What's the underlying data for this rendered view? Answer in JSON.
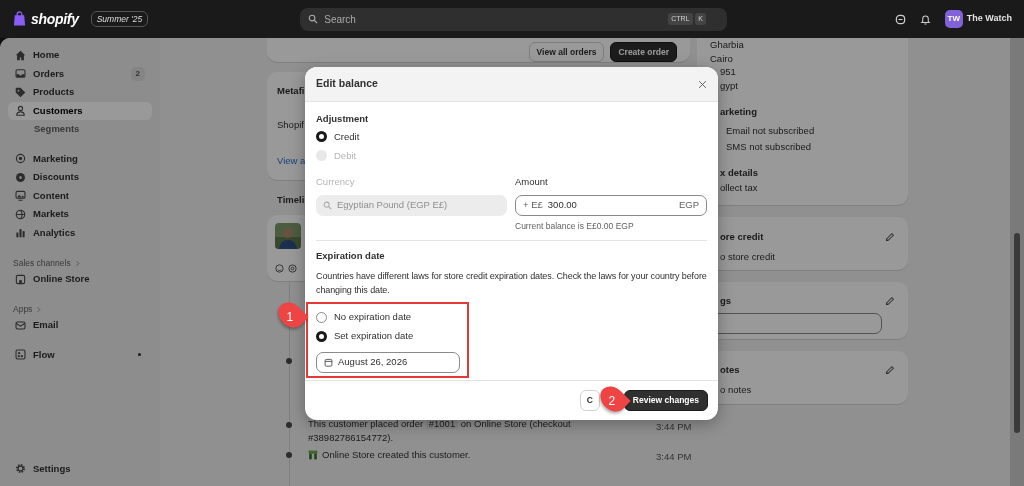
{
  "top_bar": {
    "logo": "shopify",
    "edition": "Summer '25",
    "search": {
      "placeholder": "Search"
    },
    "shortcut_keys": [
      "CTRL",
      "K"
    ],
    "account": {
      "initials": "TW",
      "name": "The Watch"
    }
  },
  "sidebar": {
    "groups": [
      [
        {
          "kind": "item",
          "label": "Home",
          "selected": false
        },
        {
          "kind": "item",
          "label": "Orders",
          "selected": false,
          "badge": "2"
        },
        {
          "kind": "item",
          "label": "Products",
          "selected": false
        },
        {
          "kind": "item",
          "label": "Customers",
          "selected": true
        },
        {
          "kind": "subitem",
          "label": "Segments",
          "selected": false
        }
      ],
      [
        {
          "kind": "item",
          "label": "Marketing",
          "selected": false
        },
        {
          "kind": "item",
          "label": "Discounts",
          "selected": false
        },
        {
          "kind": "item",
          "label": "Content",
          "selected": false
        },
        {
          "kind": "item",
          "label": "Markets",
          "selected": false
        },
        {
          "kind": "item",
          "label": "Analytics",
          "selected": false
        }
      ],
      [
        {
          "kind": "section",
          "label": "Sales channels"
        },
        {
          "kind": "item",
          "label": "Online Store",
          "selected": false
        }
      ],
      [
        {
          "kind": "section",
          "label": "Apps"
        },
        {
          "kind": "item",
          "label": "Email",
          "selected": false
        }
      ],
      [
        {
          "kind": "item",
          "label": "Flow",
          "selected": false,
          "unread": true
        }
      ]
    ],
    "settings": {
      "label": "Settings",
      "selected": false
    }
  },
  "main": {
    "orders_card": {
      "buttons": [
        {
          "label": "View all orders",
          "kind": "secondary"
        },
        {
          "label": "Create order",
          "kind": "primary"
        }
      ]
    },
    "metafields_card": {
      "title": "Metafi",
      "text": "Shopif",
      "link": "View a"
    },
    "timeline": {
      "title": "Timeli",
      "entries": [
        {
          "kind": "hidden"
        },
        {
          "kind": "order",
          "text_before": "This customer placed order",
          "order": "#1001",
          "text_after": "on Online Store (checkout #38982786154772).",
          "time": "3:44 PM"
        },
        {
          "kind": "store",
          "text": "Online Store created this customer.",
          "time": "3:44 PM"
        }
      ]
    }
  },
  "right_column": {
    "address_lines": [
      "Gharbia",
      "Cairo",
      "951",
      "gypt"
    ],
    "marketing": {
      "title": "arketing",
      "items": [
        "Email not subscribed",
        "SMS not subscribed"
      ]
    },
    "tax": {
      "title": "x details",
      "text": "ollect tax"
    },
    "store_credit": {
      "title": "ore credit",
      "text": "o store credit"
    },
    "tags": {
      "title": "gs"
    },
    "notes": {
      "title": "otes",
      "text": "o notes"
    }
  },
  "modal": {
    "title": "Edit balance",
    "adjustment": {
      "title": "Adjustment",
      "options": [
        {
          "label": "Credit",
          "selected": true,
          "disabled": false
        },
        {
          "label": "Debit",
          "selected": false,
          "disabled": true
        }
      ]
    },
    "currency": {
      "label": "Currency",
      "value": "Egyptian Pound (EGP E£)",
      "disabled": true
    },
    "amount": {
      "label": "Amount",
      "prefix": "+ E£",
      "value": "300.00",
      "suffix": "EGP",
      "help": "Current balance is E£0.00 EGP"
    },
    "expiration": {
      "title": "Expiration date",
      "description": "Countries have different laws for store credit expiration dates. Check the laws for your country before changing this date.",
      "options": [
        {
          "label": "No expiration date",
          "selected": false
        },
        {
          "label": "Set expiration date",
          "selected": true
        }
      ],
      "date": "August 26, 2026"
    },
    "buttons": [
      {
        "label": "C",
        "kind": "secondary"
      },
      {
        "label": "Review changes",
        "kind": "primary"
      }
    ]
  },
  "annotations": [
    {
      "label": "1"
    },
    {
      "label": "2"
    }
  ]
}
